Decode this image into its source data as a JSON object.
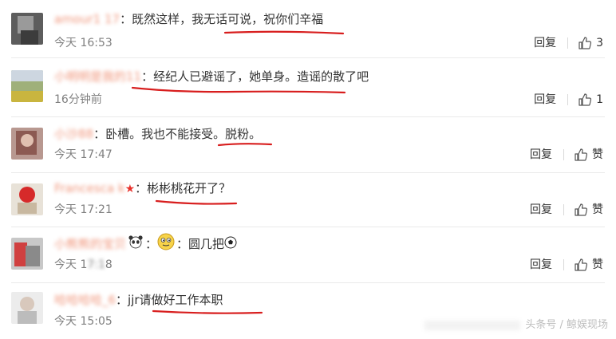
{
  "comments": [
    {
      "username": "amour1 17",
      "text": "：既然这样，我无话可说，祝你们辛福",
      "time": "今天 16:53",
      "reply_label": "回复",
      "like_label": "3"
    },
    {
      "username": "小明明是我的11",
      "text": "：经纪人已避谣了，她单身。造谣的散了吧",
      "time": "16分钟前",
      "reply_label": "回复",
      "like_label": "1"
    },
    {
      "username": "小沙88",
      "text": "：卧槽。我也不能接受。脱粉。",
      "time": "今天 17:47",
      "reply_label": "回复",
      "like_label": "赞"
    },
    {
      "username": "Francesca k",
      "text": "：彬彬桃花开了？",
      "time": "今天 17:21",
      "reply_label": "回复",
      "like_label": "赞"
    },
    {
      "username": "小熊熊的宝贝",
      "text": "：圆几把",
      "time_prefix": "今天 1",
      "time_blur": "7:1",
      "time_suffix": "8",
      "reply_label": "回复",
      "like_label": "赞"
    },
    {
      "username": "哈哈哈哈_6",
      "text": "：jjr请做好工作本职",
      "time": "今天 15:05"
    }
  ],
  "watermark": "头条号 / 鲸娱现场",
  "colors": {
    "username": "#eb7350",
    "underline": "#d81e1e",
    "time": "#808080",
    "star": "#e8312b"
  }
}
